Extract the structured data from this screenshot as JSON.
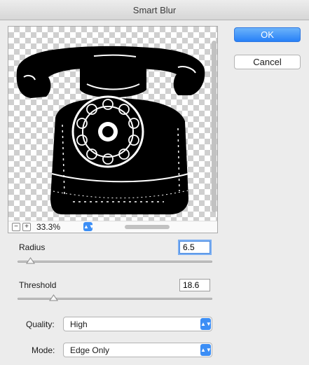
{
  "window": {
    "title": "Smart Blur"
  },
  "preview": {
    "zoom": "33.3%",
    "zoom_out": "−",
    "zoom_in": "+"
  },
  "buttons": {
    "ok": "OK",
    "cancel": "Cancel"
  },
  "radius": {
    "label": "Radius",
    "value": "6.5",
    "slider_fraction": 0.065
  },
  "threshold": {
    "label": "Threshold",
    "value": "18.6",
    "slider_fraction": 0.186
  },
  "quality": {
    "label": "Quality:",
    "value": "High"
  },
  "mode": {
    "label": "Mode:",
    "value": "Edge Only"
  },
  "colors": {
    "accent": "#2f86f6",
    "background": "#ececec"
  }
}
